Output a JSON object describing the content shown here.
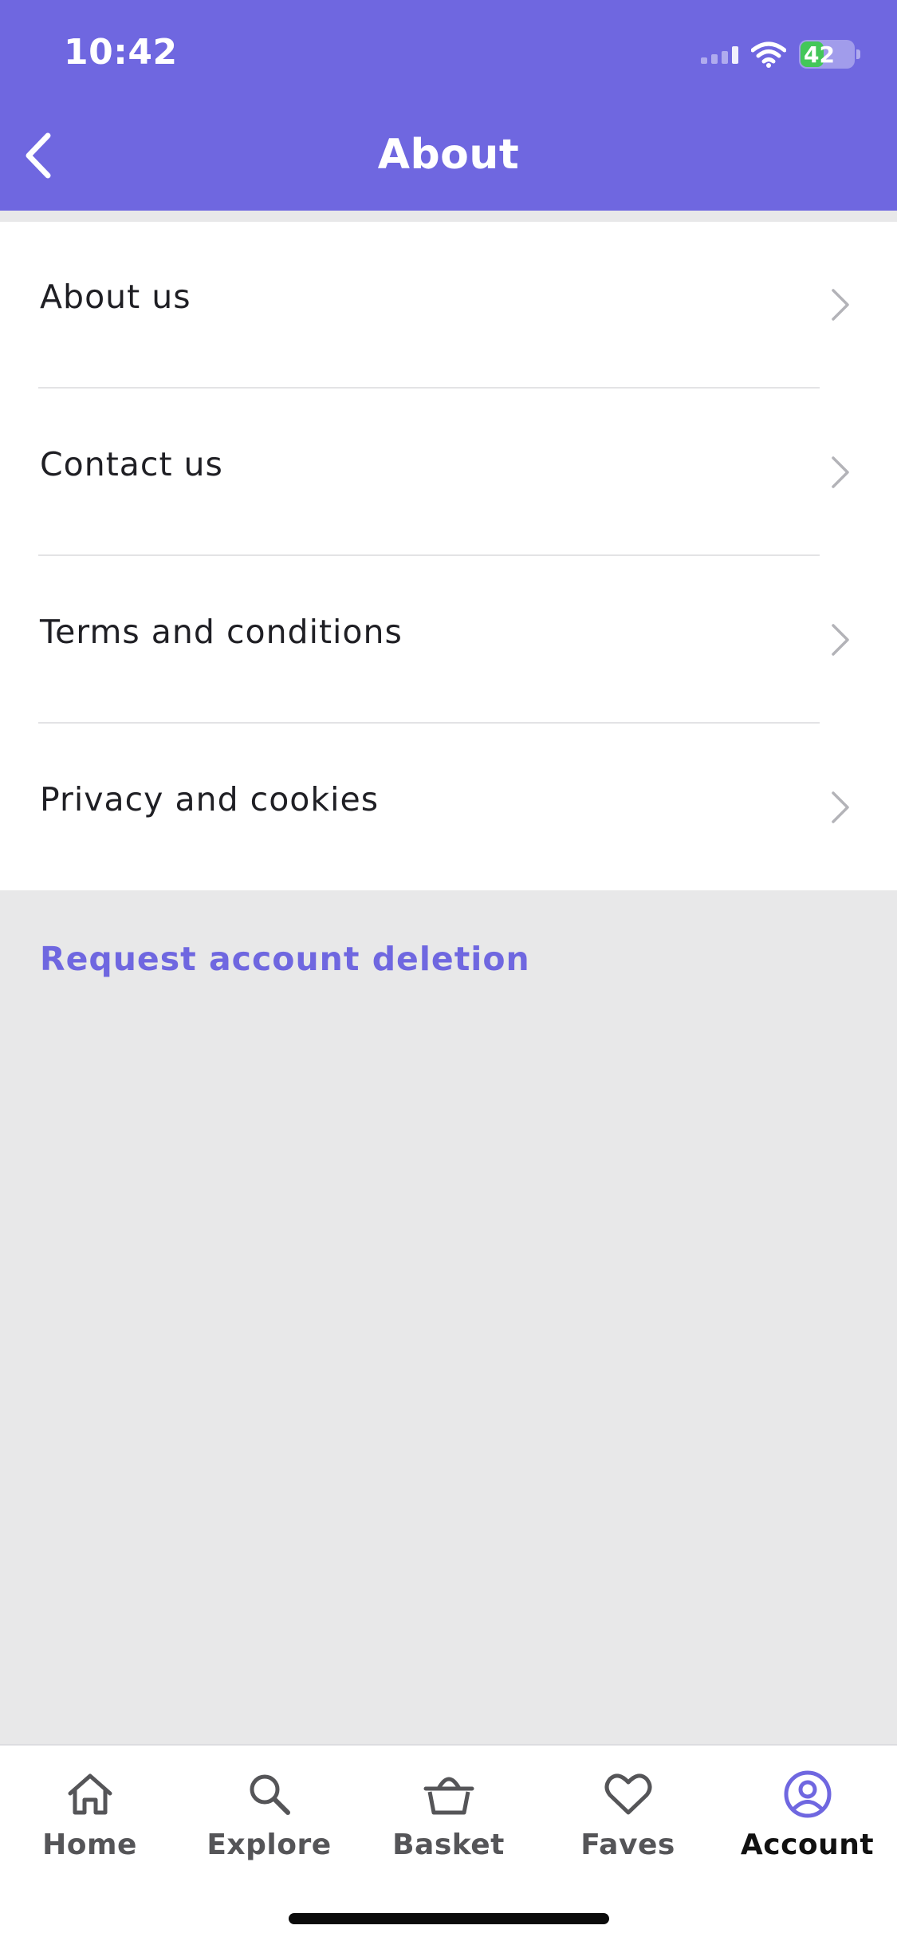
{
  "status_bar": {
    "time": "10:42",
    "battery": "42",
    "battery_level": 0.42
  },
  "header": {
    "title": "About",
    "color": "#6f67e0"
  },
  "menu": {
    "items": [
      {
        "label": "About us"
      },
      {
        "label": "Contact us"
      },
      {
        "label": "Terms and conditions"
      },
      {
        "label": "Privacy and cookies"
      }
    ]
  },
  "actions": {
    "request_deletion": "Request account deletion"
  },
  "tabbar": {
    "active": "Account",
    "tabs": [
      {
        "label": "Home",
        "icon": "home-icon"
      },
      {
        "label": "Explore",
        "icon": "search-icon"
      },
      {
        "label": "Basket",
        "icon": "basket-icon"
      },
      {
        "label": "Faves",
        "icon": "heart-icon"
      },
      {
        "label": "Account",
        "icon": "account-icon"
      }
    ]
  }
}
